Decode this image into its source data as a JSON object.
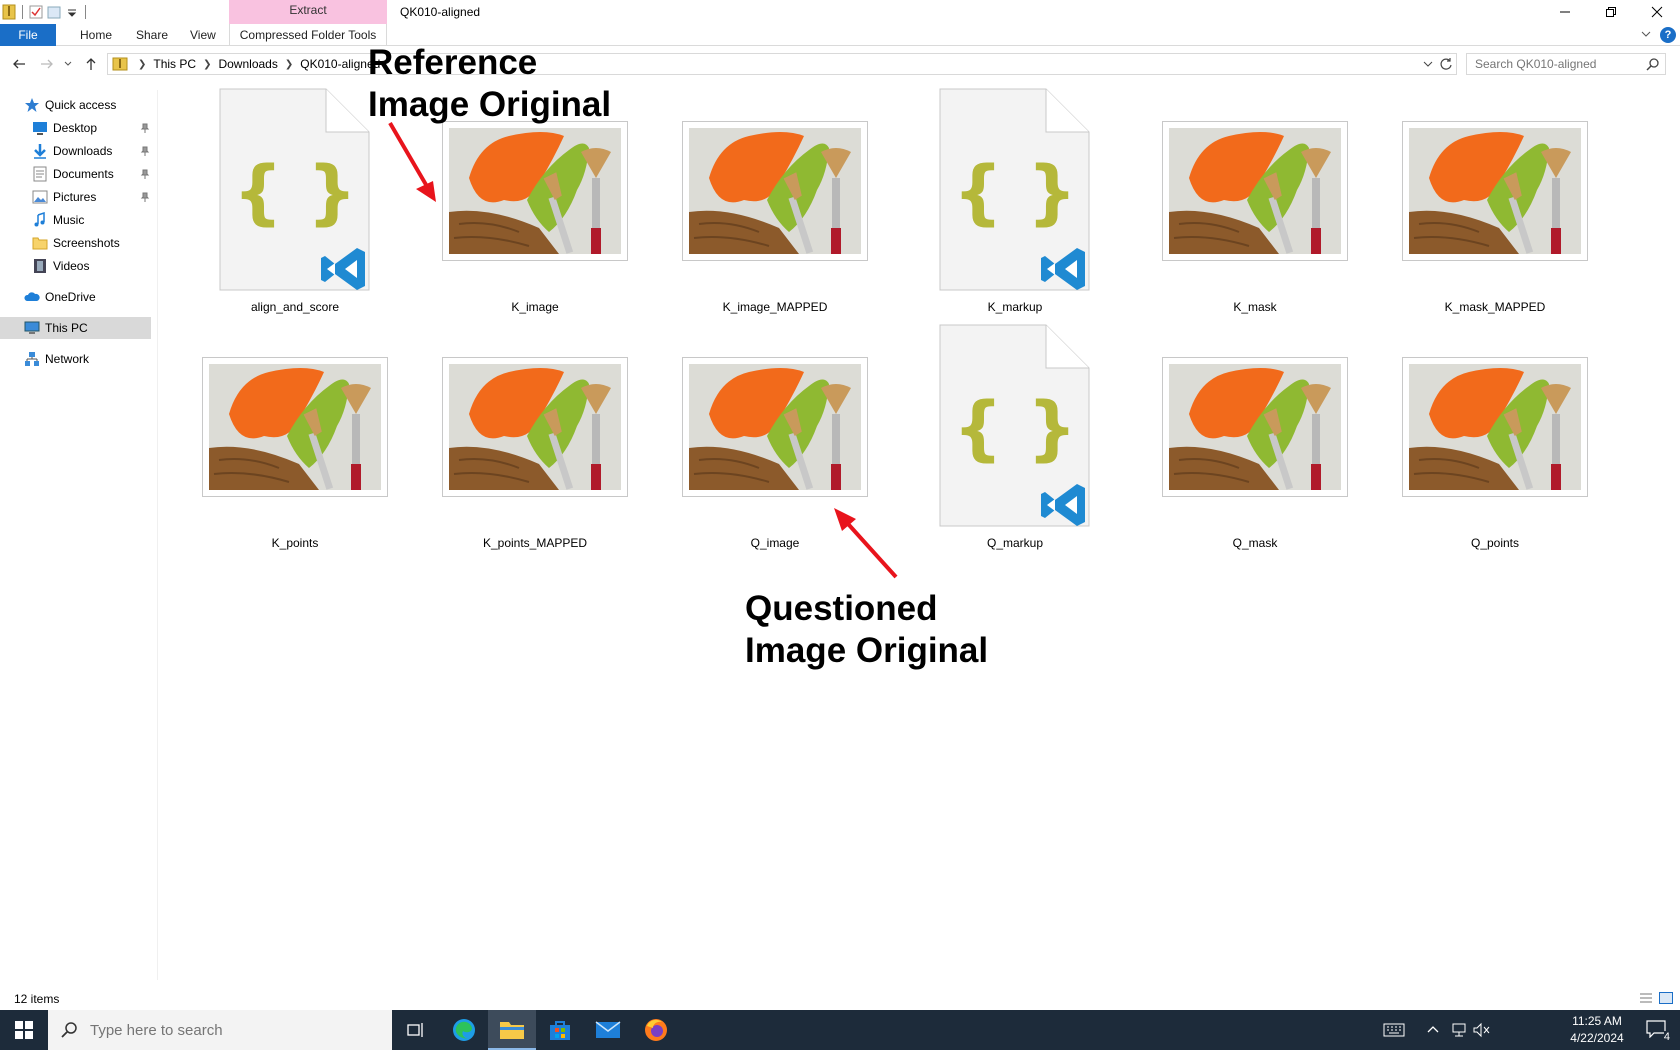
{
  "window": {
    "title": "QK010-aligned",
    "context_tab_group": "Extract"
  },
  "ribbon": {
    "tabs": [
      "File",
      "Home",
      "Share",
      "View"
    ],
    "context_tab": "Compressed Folder Tools"
  },
  "address": {
    "crumbs": [
      "This PC",
      "Downloads",
      "QK010-aligned"
    ],
    "search_placeholder": "Search QK010-aligned"
  },
  "nav": {
    "quick_access": "Quick access",
    "items": [
      {
        "label": "Desktop",
        "pinned": true
      },
      {
        "label": "Downloads",
        "pinned": true
      },
      {
        "label": "Documents",
        "pinned": true
      },
      {
        "label": "Pictures",
        "pinned": true
      },
      {
        "label": "Music",
        "pinned": false
      },
      {
        "label": "Screenshots",
        "pinned": false
      },
      {
        "label": "Videos",
        "pinned": false
      }
    ],
    "onedrive": "OneDrive",
    "this_pc": "This PC",
    "network": "Network"
  },
  "files": [
    {
      "name": "align_and_score",
      "type": "json"
    },
    {
      "name": "K_image",
      "type": "image"
    },
    {
      "name": "K_image_MAPPED",
      "type": "image"
    },
    {
      "name": "K_markup",
      "type": "json"
    },
    {
      "name": "K_mask",
      "type": "image"
    },
    {
      "name": "K_mask_MAPPED",
      "type": "image"
    },
    {
      "name": "K_points",
      "type": "image"
    },
    {
      "name": "K_points_MAPPED",
      "type": "image"
    },
    {
      "name": "Q_image",
      "type": "image"
    },
    {
      "name": "Q_markup",
      "type": "json"
    },
    {
      "name": "Q_mask",
      "type": "image"
    },
    {
      "name": "Q_points",
      "type": "image"
    }
  ],
  "annotations": {
    "reference_line1": "Reference",
    "reference_line2": "Image Original",
    "questioned_line1": "Questioned",
    "questioned_line2": "Image Original",
    "arrow_color": "#e8141c"
  },
  "status": {
    "item_count": "12 items"
  },
  "taskbar": {
    "search_placeholder": "Type here to search",
    "time": "11:25 AM",
    "date": "4/22/2024",
    "notification_count": "4"
  },
  "colors": {
    "accent": "#1a6ec7",
    "context_tab": "#f9c2e0",
    "taskbar": "#1d2b3a",
    "json_brace": "#b5b83a",
    "vscode_blue": "#1f8ad2"
  }
}
